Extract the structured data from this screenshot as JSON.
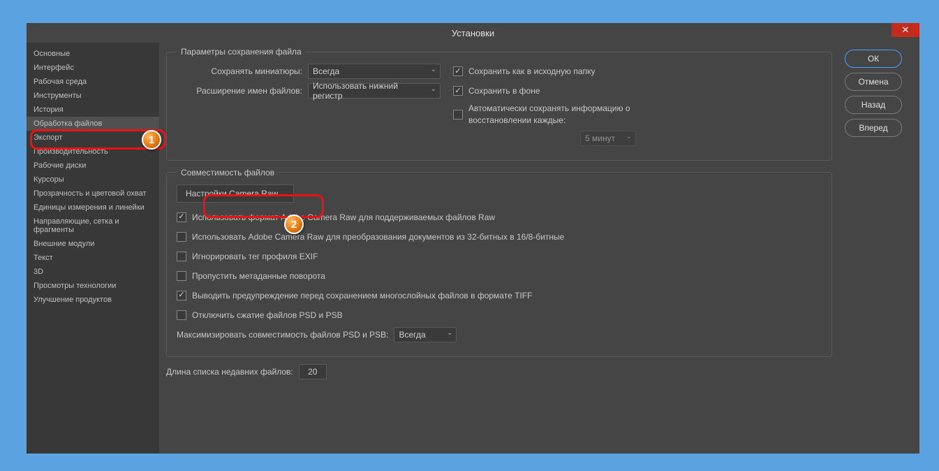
{
  "title": "Установки",
  "sidebar": {
    "items": [
      "Основные",
      "Интерфейс",
      "Рабочая среда",
      "Инструменты",
      "История",
      "Обработка файлов",
      "Экспорт",
      "Производительность",
      "Рабочие диски",
      "Курсоры",
      "Прозрачность и цветовой охват",
      "Единицы измерения и линейки",
      "Направляющие, сетка и фрагменты",
      "Внешние модули",
      "Текст",
      "3D",
      "Просмотры технологии",
      "Улучшение продуктов"
    ],
    "selectedIndex": 5
  },
  "buttons": {
    "ok": "ОК",
    "cancel": "Отмена",
    "back": "Назад",
    "forward": "Вперед"
  },
  "section1": {
    "legend": "Параметры сохранения файла",
    "thumb_label": "Сохранять миниатюры:",
    "thumb_value": "Всегда",
    "ext_label": "Расширение имен файлов:",
    "ext_value": "Использовать нижний регистр",
    "save_orig": "Сохранить как в исходную папку",
    "save_bg": "Сохранить в фоне",
    "autosave": "Автоматически сохранять информацию о восстановлении каждые:",
    "autosave_value": "5 минут"
  },
  "section2": {
    "legend": "Совместимость файлов",
    "camera_btn": "Настройки Camera Raw...",
    "opts": [
      {
        "label": "Использовать формат Adobe Camera Raw для поддерживаемых файлов Raw",
        "checked": true
      },
      {
        "label": "Использовать Adobe Camera Raw для преобразования документов из 32-битных в 16/8-битные",
        "checked": false
      },
      {
        "label": "Игнорировать тег профиля EXIF",
        "checked": false
      },
      {
        "label": "Пропустить метаданные поворота",
        "checked": false
      },
      {
        "label": "Выводить предупреждение перед сохранением многослойных файлов в формате TIFF",
        "checked": true
      },
      {
        "label": "Отключить сжатие файлов PSD и PSB",
        "checked": false
      }
    ],
    "max_label": "Максимизировать совместимость файлов PSD и PSB:",
    "max_value": "Всегда"
  },
  "recent": {
    "label": "Длина списка недавних файлов:",
    "value": "20"
  },
  "badges": {
    "b1": "1",
    "b2": "2"
  }
}
